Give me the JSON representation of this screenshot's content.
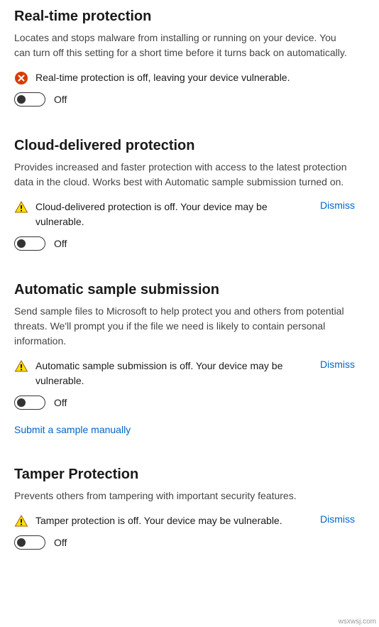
{
  "sections": {
    "realtime": {
      "title": "Real-time protection",
      "desc": "Locates and stops malware from installing or running on your device. You can turn off this setting for a short time before it turns back on automatically.",
      "alert": "Real-time protection is off, leaving your device vulnerable.",
      "toggle_state": "Off"
    },
    "cloud": {
      "title": "Cloud-delivered protection",
      "desc": "Provides increased and faster protection with access to the latest protection data in the cloud. Works best with Automatic sample submission turned on.",
      "alert": "Cloud-delivered protection is off. Your device may be vulnerable.",
      "dismiss": "Dismiss",
      "toggle_state": "Off"
    },
    "sample": {
      "title": "Automatic sample submission",
      "desc": "Send sample files to Microsoft to help protect you and others from potential threats. We'll prompt you if the file we need is likely to contain personal information.",
      "alert": "Automatic sample submission is off. Your device may be vulnerable.",
      "dismiss": "Dismiss",
      "toggle_state": "Off",
      "link": "Submit a sample manually"
    },
    "tamper": {
      "title": "Tamper Protection",
      "desc": "Prevents others from tampering with important security features.",
      "alert": "Tamper protection is off. Your device may be vulnerable.",
      "dismiss": "Dismiss",
      "toggle_state": "Off"
    }
  },
  "watermark": "wsxwsj.com"
}
